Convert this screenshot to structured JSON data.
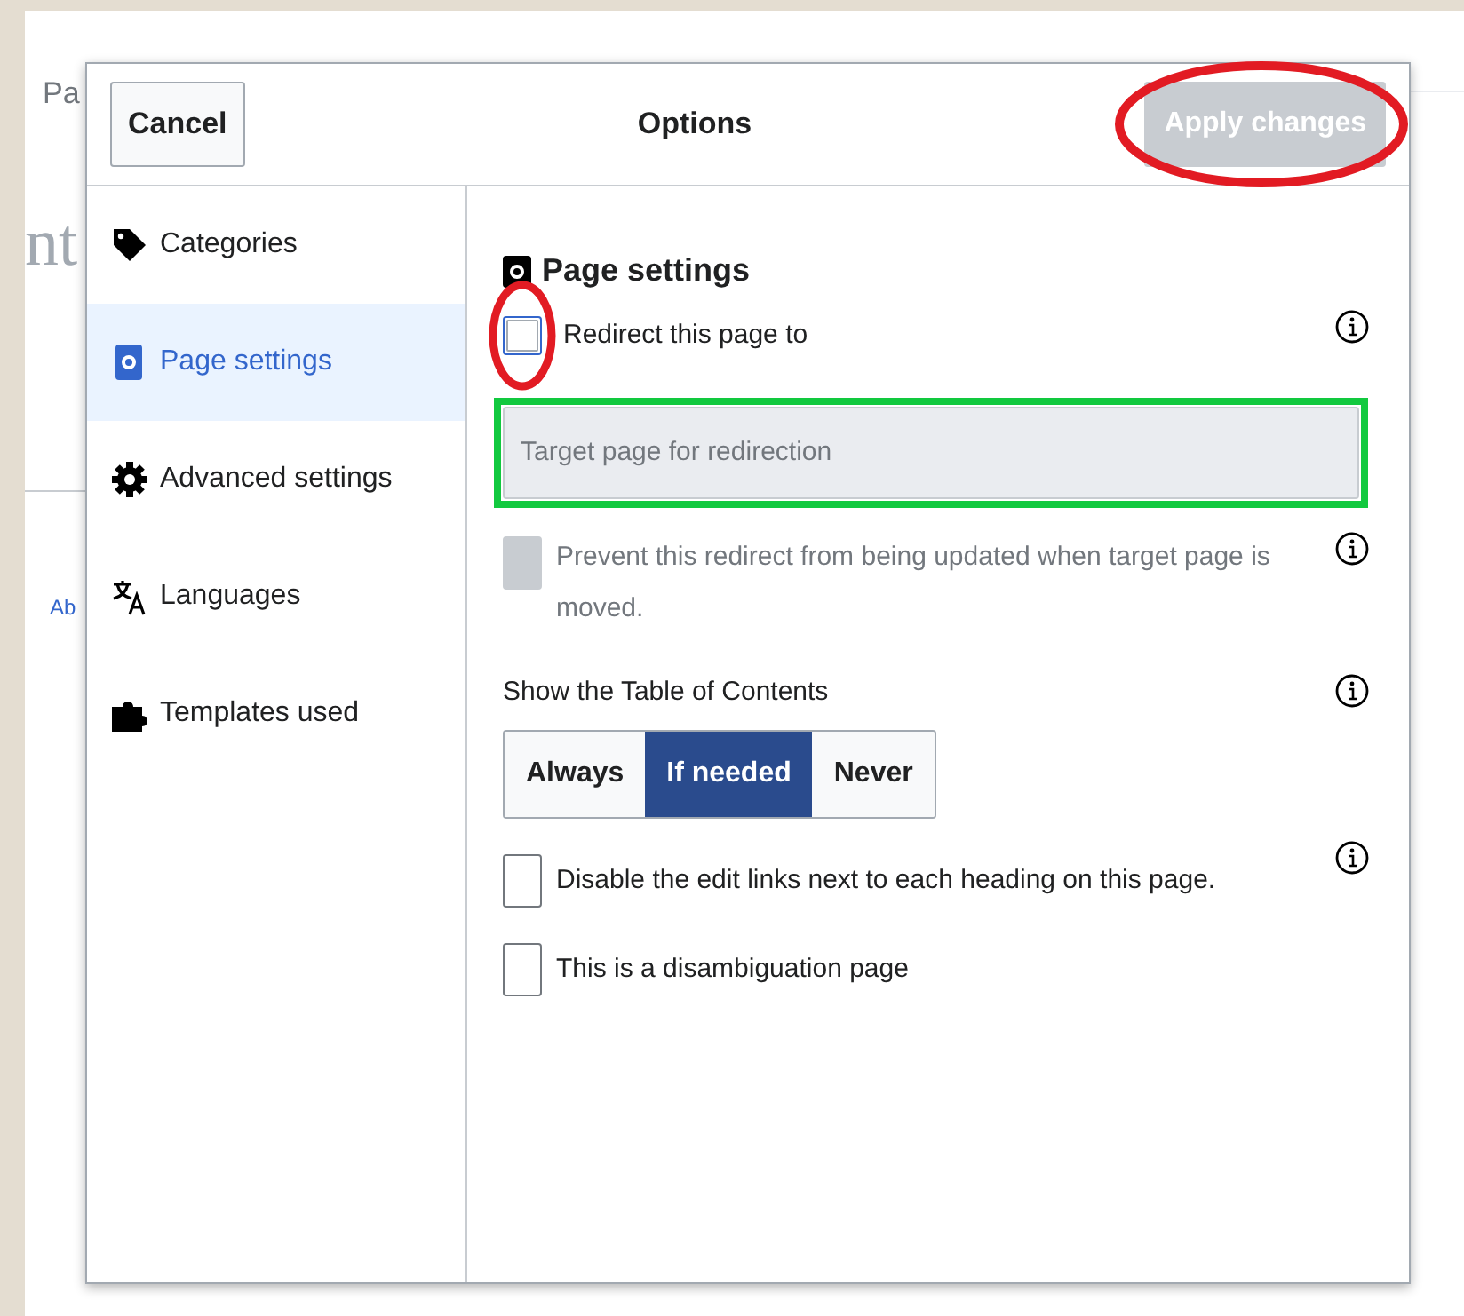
{
  "background_page": {
    "tab_label": "Pa",
    "heading": "nt",
    "link": "Ab"
  },
  "dialog": {
    "title": "Options",
    "cancel_button": "Cancel",
    "apply_button": {
      "label": "Apply changes",
      "disabled": true,
      "circled": true
    }
  },
  "sidebar": {
    "items": [
      {
        "label": "Categories",
        "selected": false
      },
      {
        "label": "Page settings",
        "selected": true
      },
      {
        "label": "Advanced settings",
        "selected": false
      },
      {
        "label": "Languages",
        "selected": false
      },
      {
        "label": "Templates used",
        "selected": false
      }
    ]
  },
  "section": {
    "title": "Page settings"
  },
  "redirect": {
    "label": "Redirect this page to",
    "checked": false,
    "focused": true,
    "circled": true,
    "has_info": true
  },
  "target_field": {
    "placeholder": "Target page for redirection",
    "disabled": true,
    "boxed": true
  },
  "prevent_redirect": {
    "label": "Prevent this redirect from being updated when target page is moved.",
    "checked": false,
    "disabled": true,
    "has_info": true
  },
  "toc": {
    "label": "Show the Table of Contents",
    "has_info": true,
    "options": [
      {
        "label": "Always",
        "selected": false
      },
      {
        "label": "If needed",
        "selected": true
      },
      {
        "label": "Never",
        "selected": false
      }
    ]
  },
  "options": [
    {
      "label": "Disable the edit links next to each heading on this page.",
      "checked": false,
      "has_info": true
    },
    {
      "label": "This is a disambiguation page",
      "checked": false,
      "has_info": false
    }
  ]
}
